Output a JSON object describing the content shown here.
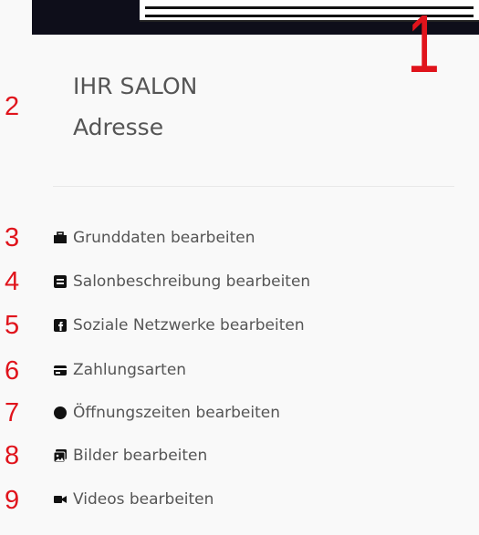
{
  "header": {
    "marker_1": "1"
  },
  "salon": {
    "number": "2",
    "name": "IHR SALON",
    "address": "Adresse"
  },
  "menu": [
    {
      "number": "3",
      "label": "Grunddaten bearbeiten",
      "icon": "briefcase-icon"
    },
    {
      "number": "4",
      "label": "Salonbeschreibung bearbeiten",
      "icon": "book-icon"
    },
    {
      "number": "5",
      "label": "Soziale Netzwerke bearbeiten",
      "icon": "facebook-icon"
    },
    {
      "number": "6",
      "label": "Zahlungsarten",
      "icon": "credit-card-icon"
    },
    {
      "number": "7",
      "label": "Öffnungszeiten bearbeiten",
      "icon": "clock-icon"
    },
    {
      "number": "8",
      "label": "Bilder bearbeiten",
      "icon": "images-icon"
    },
    {
      "number": "9",
      "label": "Videos bearbeiten",
      "icon": "video-icon"
    }
  ],
  "colors": {
    "annotation_red": "#e0141c",
    "text_gray": "#555555",
    "topbar": "#0e0e1a"
  }
}
